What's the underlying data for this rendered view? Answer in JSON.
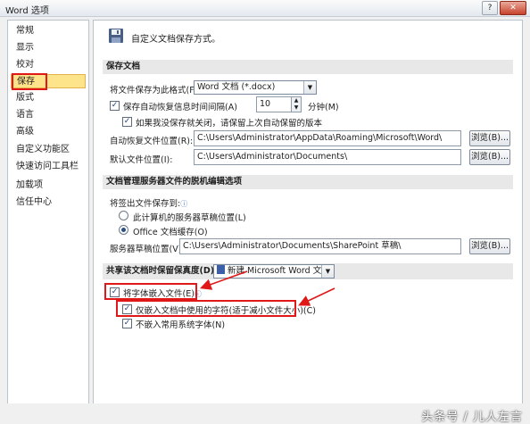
{
  "window": {
    "title": "Word 选项"
  },
  "sidebar": {
    "items": [
      {
        "label": "常规"
      },
      {
        "label": "显示"
      },
      {
        "label": "校对"
      },
      {
        "label": "保存"
      },
      {
        "label": "版式"
      },
      {
        "label": "语言"
      },
      {
        "label": "高级"
      },
      {
        "label": "自定义功能区"
      },
      {
        "label": "快速访问工具栏"
      },
      {
        "label": "加载项"
      },
      {
        "label": "信任中心"
      }
    ],
    "selected_index": 3
  },
  "main": {
    "header_text": "自定义文档保存方式。",
    "save_docs": {
      "section_title": "保存文档",
      "format_label": "将文件保存为此格式(F):",
      "format_value": "Word 文档 (*.docx)",
      "autorecover_label": "保存自动恢复信息时间间隔(A)",
      "autorecover_minutes": "10",
      "minutes_label": "分钟(M)",
      "keep_last_label": "如果我没保存就关闭，请保留上次自动保留的版本",
      "autorecover_location_label": "自动恢复文件位置(R):",
      "autorecover_location_value": "C:\\Users\\Administrator\\AppData\\Roaming\\Microsoft\\Word\\",
      "default_location_label": "默认文件位置(I):",
      "default_location_value": "C:\\Users\\Administrator\\Documents\\",
      "browse_label": "浏览(B)..."
    },
    "offline": {
      "section_title": "文档管理服务器文件的脱机编辑选项",
      "save_to_label": "将签出文件保存到:",
      "option_server": "此计算机的服务器草稿位置(L)",
      "option_office": "Office 文档缓存(O)",
      "drafts_label": "服务器草稿位置(V):",
      "drafts_value": "C:\\Users\\Administrator\\Documents\\SharePoint 草稿\\",
      "browse_label": "浏览(B)..."
    },
    "fidelity": {
      "section_title": "共享该文档时保留保真度(D):",
      "doc_value": "新建 Microsoft Word 文档",
      "embed_fonts_label": "将字体嵌入文件(E)",
      "embed_used_only_label": "仅嵌入文档中使用的字符(适于减小文件大小)(C)",
      "no_common_fonts_label": "不嵌入常用系统字体(N)"
    }
  },
  "footer": {
    "watermark": "头条号 / 儿人左言"
  },
  "colors": {
    "selected_bg": "#fde48a",
    "annotation_red": "#e01818",
    "section_bg": "#e8e8e8"
  }
}
